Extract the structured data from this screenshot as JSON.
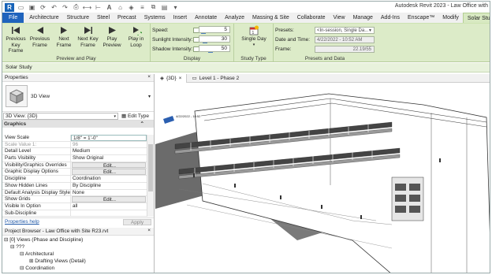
{
  "app_title": "Autodesk Revit 2023 - Law Office with",
  "tabs": [
    "File",
    "Architecture",
    "Structure",
    "Steel",
    "Precast",
    "Systems",
    "Insert",
    "Annotate",
    "Analyze",
    "Massing & Site",
    "Collaborate",
    "View",
    "Manage",
    "Add-Ins",
    "Enscape™",
    "Modify",
    "Solar Study"
  ],
  "active_tab": "Solar Study",
  "ribbon": {
    "preview": {
      "title": "Preview and Play",
      "buttons": [
        {
          "label": "Previous Key Frame",
          "icon": "previous-key-frame-icon"
        },
        {
          "label": "Previous Frame",
          "icon": "previous-frame-icon"
        },
        {
          "label": "Next Frame",
          "icon": "next-frame-icon"
        },
        {
          "label": "Next Key Frame",
          "icon": "next-key-frame-icon"
        },
        {
          "label": "Play Preview",
          "icon": "play-preview-icon"
        },
        {
          "label": "Play in Loop",
          "icon": "play-loop-icon"
        }
      ]
    },
    "display": {
      "title": "Display",
      "speed_label": "Speed:",
      "speed_value": "5",
      "sunlight_label": "Sunlight Intensity:",
      "sunlight_value": "30",
      "shadow_label": "Shadow Intensity:",
      "shadow_value": "50"
    },
    "study_type": {
      "title": "Study Type",
      "button_label": "Single Day"
    },
    "presets": {
      "title": "Presets and Data",
      "presets_label": "Presets:",
      "presets_value": "<In-session, Single Da...",
      "datetime_label": "Date and Time:",
      "datetime_value": "4/22/2022 - 10:52 AM",
      "frame_label": "Frame:",
      "frame_value": "22.19/55"
    }
  },
  "solar_bar": "Solar Study",
  "properties": {
    "header": "Properties",
    "type_name": "3D View",
    "view_selector": "3D View: {3D}",
    "edit_type": "Edit Type",
    "group": "Graphics",
    "rows": [
      {
        "name": "View Scale",
        "value": "1/8\" = 1'-0\"",
        "style": "input"
      },
      {
        "name": "Scale Value    1:",
        "value": "96",
        "style": "gray"
      },
      {
        "name": "Detail Level",
        "value": "Medium",
        "style": ""
      },
      {
        "name": "Parts Visibility",
        "value": "Show Original",
        "style": ""
      },
      {
        "name": "Visibility/Graphics Overrides",
        "value": "Edit...",
        "style": "button"
      },
      {
        "name": "Graphic Display Options",
        "value": "Edit...",
        "style": "button"
      },
      {
        "name": "Discipline",
        "value": "Coordination",
        "style": ""
      },
      {
        "name": "Show Hidden Lines",
        "value": "By Discipline",
        "style": ""
      },
      {
        "name": "Default Analysis Display Style",
        "value": "None",
        "style": ""
      },
      {
        "name": "Show Grids",
        "value": "Edit...",
        "style": "button"
      },
      {
        "name": "Visible In Option",
        "value": "all",
        "style": ""
      },
      {
        "name": "Sub-Discipline",
        "value": "",
        "style": ""
      }
    ],
    "help_link": "Properties help",
    "apply": "Apply"
  },
  "project_browser": {
    "header": "Project Browser - Law Office with Site R23.rvt",
    "items": [
      {
        "text": "⊟ [0] Views (Phase and Discipline)",
        "indent": 2
      },
      {
        "text": "⊟ ???",
        "indent": 10
      },
      {
        "text": "⊟ Architectural",
        "indent": 22
      },
      {
        "text": "⊞ Drafting Views (Detail)",
        "indent": 34
      },
      {
        "text": "⊟ Coordination",
        "indent": 22
      }
    ]
  },
  "view_tabs": [
    {
      "label": "{3D}",
      "icon": "3d-view-icon",
      "active": true
    },
    {
      "label": "Level 1 - Phase 2",
      "icon": "floor-plan-icon",
      "active": false
    }
  ],
  "viewcube_label": "4/22/2022 - 10:52"
}
